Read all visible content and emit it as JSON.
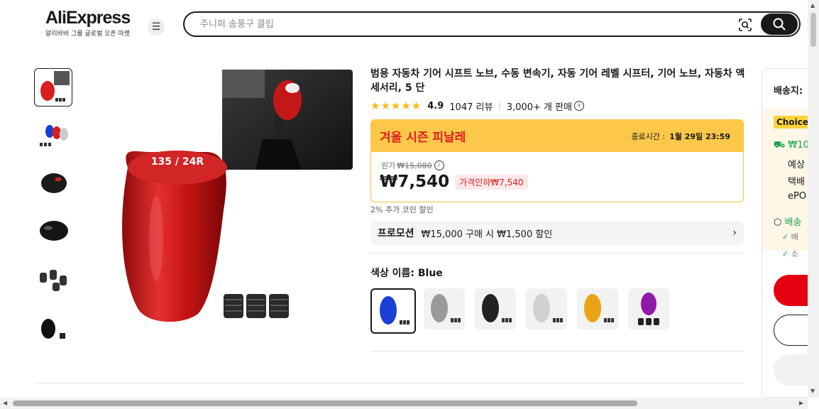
{
  "header": {
    "logo_text": "AliExpress",
    "logo_sub": "알리바바 그룹 글로벌 오픈 마켓",
    "search_placeholder": "주니퍼 송풍구 클립"
  },
  "product": {
    "title": "범용 자동차 기어 시프트 노브, 수동 변속기, 자동 기어 레벨 시프터, 기어 노브, 자동차 액세서리, 5 단",
    "stars": "★★★★★",
    "rating": "4.9",
    "reviews": "1047 리뷰",
    "sold": "3,000+ 개 판매",
    "knob_text": "135 / 24R"
  },
  "sale": {
    "name": "겨울 시즌 피날레",
    "end_label": "종료시간 :",
    "end_time": "1월 29일 23:59",
    "orig_label": "원가",
    "orig_price": "₩15,080",
    "price": "₩7,540",
    "cut_badge": "가격인하₩7,540",
    "coin_text": "2% 추가 코인 할인"
  },
  "promotion": {
    "label": "프로모션",
    "text": "₩15,000 구매 시 ₩1,500 할인"
  },
  "color": {
    "label": "색상 이름: Blue",
    "options": [
      {
        "name": "blue",
        "color": "#1a3fd6"
      },
      {
        "name": "gray",
        "color": "#9a9a9a"
      },
      {
        "name": "black",
        "color": "#222222"
      },
      {
        "name": "silver",
        "color": "#d0d0d0"
      },
      {
        "name": "gold",
        "color": "#e8a412"
      },
      {
        "name": "purple",
        "color": "#8e1aa8"
      }
    ]
  },
  "side": {
    "ship_label": "배송지:",
    "choice": "Choice",
    "line1": "₩10,",
    "line2": "예상",
    "line3": "택배",
    "line4": "ePO",
    "line5": "배송",
    "line6": "배",
    "line7": "소"
  },
  "colors": {
    "accent_red": "#e02020",
    "sale_yellow": "#fdc84a",
    "choice_yellow": "#fdd33c"
  }
}
